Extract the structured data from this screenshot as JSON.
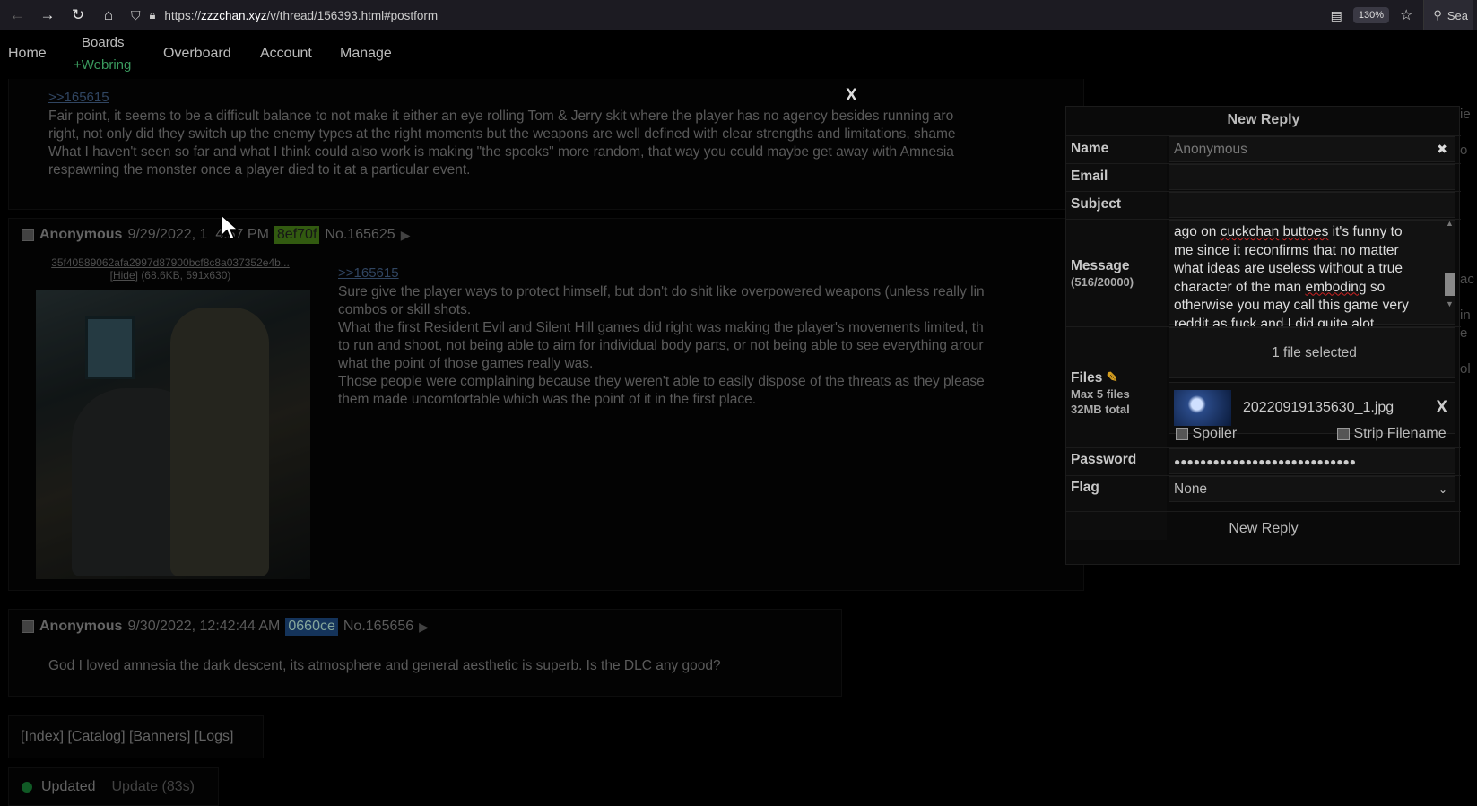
{
  "browser": {
    "url_prefix": "https://",
    "url_host": "zzzchan.xyz",
    "url_path": "/v/thread/156393.html#postform",
    "zoom": "130%",
    "search_label": "Sea"
  },
  "nav": {
    "home": "Home",
    "boards": "Boards",
    "webring": "+Webring",
    "overboard": "Overboard",
    "account": "Account",
    "manage": "Manage"
  },
  "post1": {
    "quote": ">>165615",
    "lines": [
      "Fair point, it seems to be a difficult balance to not make it either an eye rolling Tom & Jerry skit where the player has no agency besides running aro",
      "right, not only did they switch up the enemy types at the right moments but the weapons are well defined with clear strengths and limitations, shame",
      "What I haven't seen so far and what I think could also work is making \"the spooks\" more random, that way you could maybe get away with Amnesia",
      "respawning the monster once a player died to it at a particular event."
    ]
  },
  "post2": {
    "name": "Anonymous",
    "date": "9/29/2022, 1",
    "time_tail": "4:57 PM",
    "id": "8ef70f",
    "number": "No.165625",
    "file_hash": "35f40589062afa2997d87900bcf8c8a037352e4b...",
    "hide": "Hide",
    "file_meta": "(68.6KB, 591x630)",
    "quote": ">>165615",
    "lines": [
      "Sure give the player ways to protect himself, but don't do shit like overpowered weapons (unless really lin",
      "combos or skill shots.",
      "What the first Resident Evil and Silent Hill games did right was making the player's movements limited, th",
      "to run and shoot, not being able to aim for individual body parts, or not being able to see everything arour",
      "what the point of those games really was.",
      "Those people were complaining because they weren't able to easily dispose of the threats as they please",
      "them made uncomfortable which was the point of it in the first place."
    ]
  },
  "post3": {
    "name": "Anonymous",
    "date": "9/30/2022, 12:42:44 AM",
    "id": "0660ce",
    "number": "No.165656",
    "text": "God I loved amnesia the dark descent, its atmosphere and general aesthetic is superb. Is the DLC any good?"
  },
  "footer": {
    "links": "[Index] [Catalog] [Banners] [Logs]",
    "updated": "Updated",
    "update_countdown": "Update (83s)"
  },
  "overlay_close": "X",
  "reply_form": {
    "title": "New Reply",
    "name_label": "Name",
    "name_placeholder": "Anonymous",
    "clear_name": "✖",
    "email_label": "Email",
    "subject_label": "Subject",
    "message_label": "Message",
    "message_count": "(516/20000)",
    "message_lines": [
      "ago on cuckchan buttoes it's funny to",
      "me since it reconfirms that no matter",
      "what ideas are useless without a true",
      "character of the man emboding so",
      "otherwise you may call this game very",
      "reddit as fuck and I did quite alot"
    ],
    "files_label": "Files",
    "files_limit": "Max 5 files",
    "files_size": "32MB total",
    "files_selected": "1 file selected",
    "file_name": "20220919135630_1.jpg",
    "remove_file": "X",
    "spoiler": "Spoiler",
    "strip_filename": "Strip Filename",
    "password_label": "Password",
    "password_value": "●●●●●●●●●●●●●●●●●●●●●●●●●●●●",
    "flag_label": "Flag",
    "flag_value": "None",
    "submit": "New Reply"
  },
  "right_edge": [
    "ie",
    "o",
    "ac",
    "in",
    "e",
    "ol"
  ]
}
